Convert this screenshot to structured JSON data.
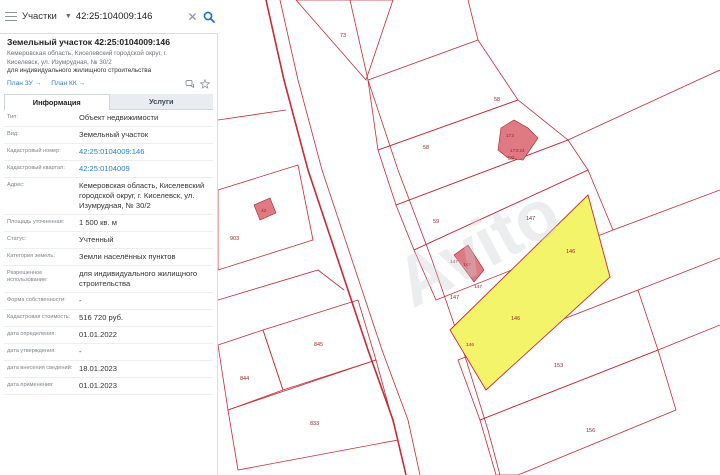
{
  "search": {
    "layer": "Участки",
    "query": "42:25:104009:146"
  },
  "object": {
    "title": "Земельный участок 42:25:0104009:146",
    "address": "Кемеровская область, Киселевский городской округ, г. Киселевск, ул. Изумрудная, № 30/2",
    "purpose": "для индивидуального жилищного строительства",
    "plan_zu": "План ЗУ",
    "plan_kk": "План КК"
  },
  "tabs": {
    "info": "Информация",
    "services": "Услуги"
  },
  "props": [
    {
      "label": "Тип:",
      "value": "Объект недвижимости"
    },
    {
      "label": "Вид:",
      "value": "Земельный участок"
    },
    {
      "label": "Кадастровый номер:",
      "value": "42:25:0104009:146"
    },
    {
      "label": "Кадастровый квартал:",
      "value": "42:25:0104009"
    },
    {
      "label": "Адрес:",
      "value": "Кемеровская область, Киселевский городской округ, г. Киселевск, ул. Изумрудная, № 30/2"
    },
    {
      "label": "Площадь уточненная:",
      "value": "1 500 кв. м"
    },
    {
      "label": "Статус:",
      "value": "Учтенный"
    },
    {
      "label": "Категория земель:",
      "value": "Земли населённых пунктов"
    },
    {
      "label": "Разрешенное использование:",
      "value": "для индивидуального жилищного строительства"
    },
    {
      "label": "Форма собственности:",
      "value": "-"
    },
    {
      "label": "Кадастровая стоимость:",
      "value": "516 720 руб."
    },
    {
      "label": "дата определения:",
      "value": "01.01.2022"
    },
    {
      "label": "дата утверждения:",
      "value": "-"
    },
    {
      "label": "дата внесения сведений:",
      "value": "18.01.2023"
    },
    {
      "label": "дата применения:",
      "value": "01.01.2023"
    }
  ],
  "map": {
    "parcel_labels": [
      "73",
      "58",
      "58",
      "59",
      "59",
      "147",
      "147",
      "147",
      "147",
      "146",
      "146",
      "146",
      "903",
      "845",
      "844",
      "833",
      "153",
      "156"
    ],
    "building_labels": [
      "42",
      "173",
      "173:24",
      "147"
    ],
    "watermark": "Avito"
  },
  "colors": {
    "accent": "#1e6fd0",
    "link": "#2a7fc7",
    "parcel_border": "#c62b36",
    "selected_fill": "#f4f46a",
    "building_fill": "#e07a82"
  }
}
